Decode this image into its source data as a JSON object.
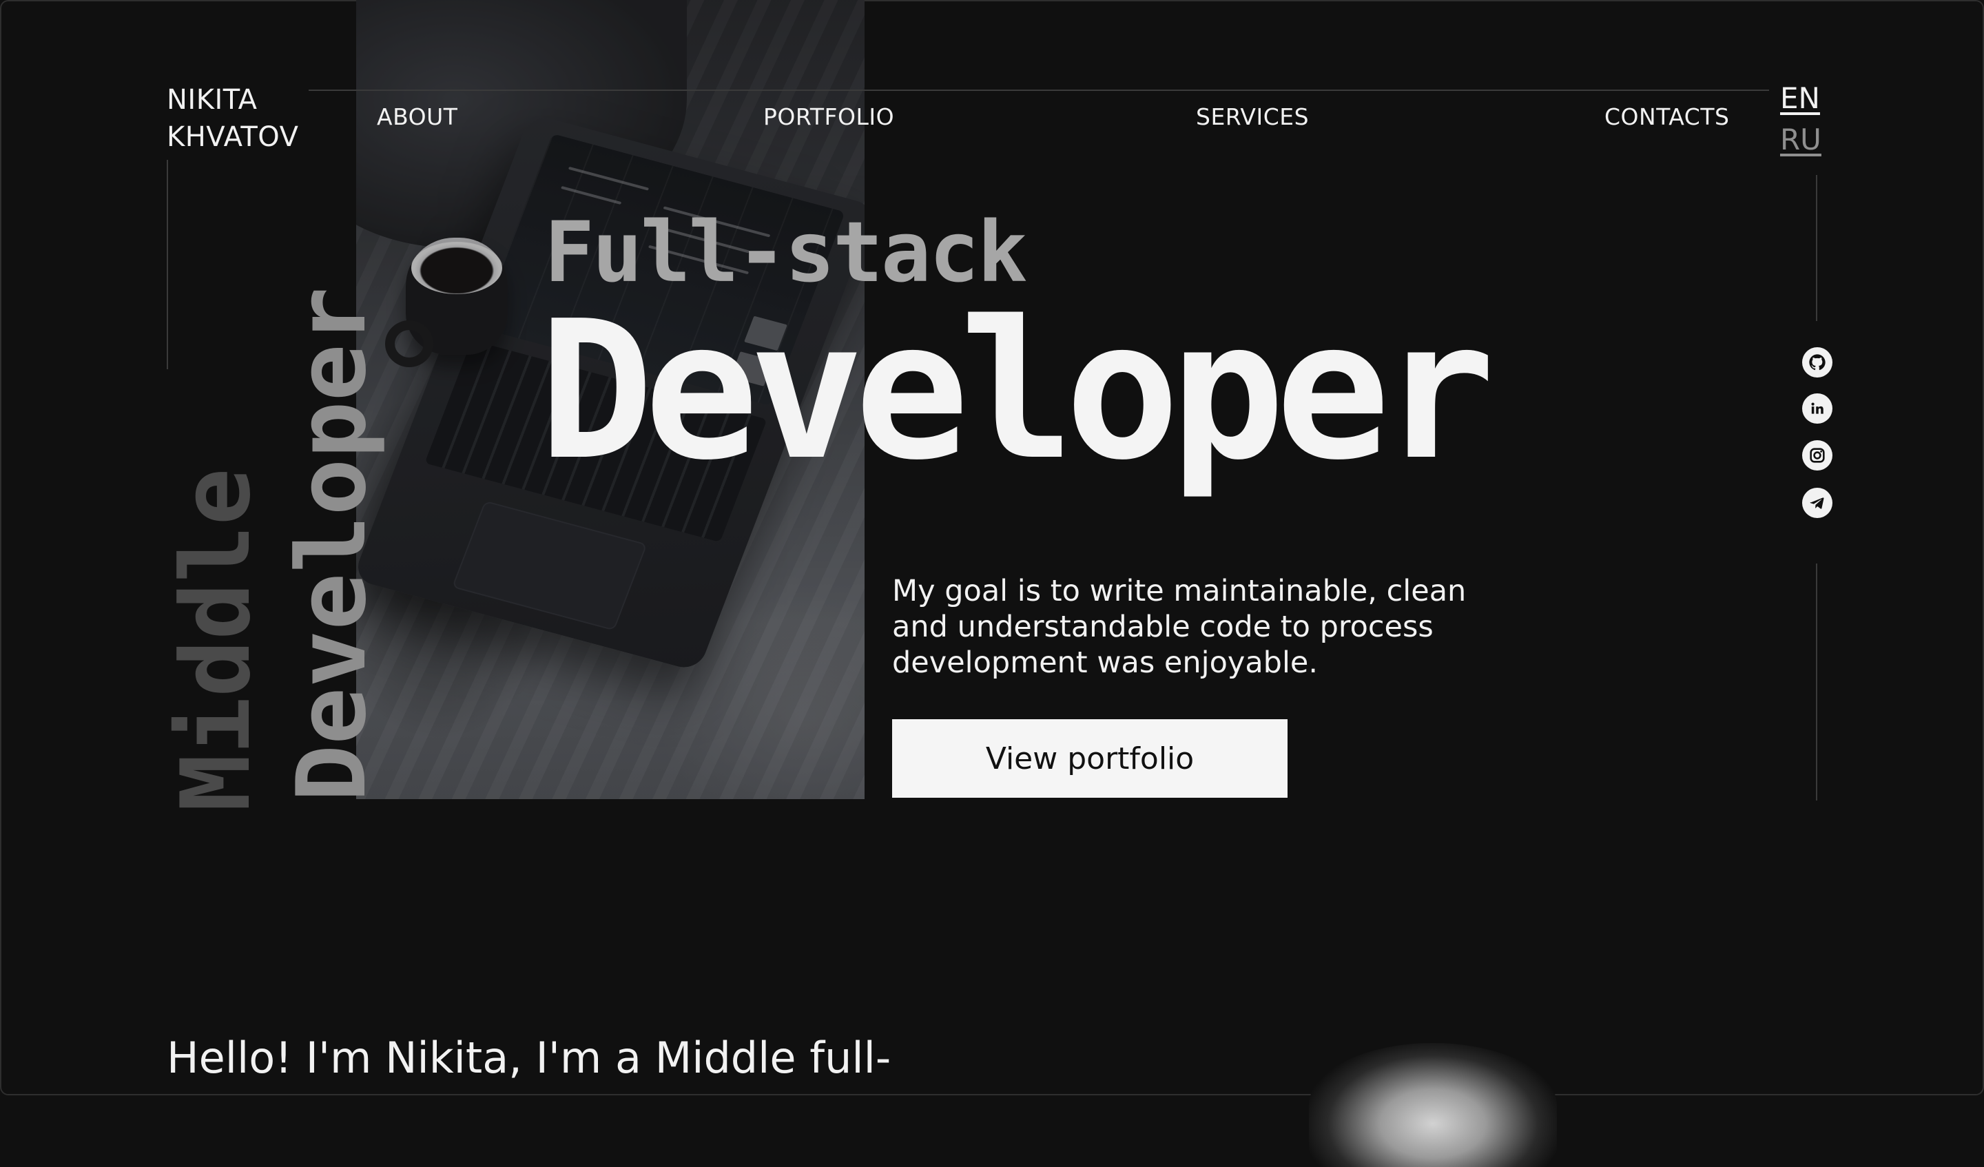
{
  "brand": {
    "line1": "NIKITA",
    "line2": "KHVATOV"
  },
  "nav": {
    "about": "ABOUT",
    "portfolio": "PORTFOLIO",
    "services": "SERVICES",
    "contacts": "CONTACTS"
  },
  "languages": {
    "en": "EN",
    "ru": "RU",
    "active": "EN"
  },
  "social_icons": [
    "github-icon",
    "linkedin-icon",
    "instagram-icon",
    "telegram-icon"
  ],
  "side_text": {
    "middle": "Middle",
    "developer": "Developer"
  },
  "hero": {
    "title_small": "Full-stack",
    "title_big": "Developer",
    "goal_line1": "My goal is to write maintainable, clean",
    "goal_line2": "and understandable code to process",
    "goal_line3": "development was enjoyable.",
    "cta_label": "View portfolio"
  },
  "about": {
    "hello": "Hello! I'm Nikita, I'm a Middle full-"
  },
  "colors": {
    "background": "#101010",
    "text": "#f2f2f2",
    "muted": "#8f8f8f",
    "button_bg": "#f5f5f5"
  }
}
